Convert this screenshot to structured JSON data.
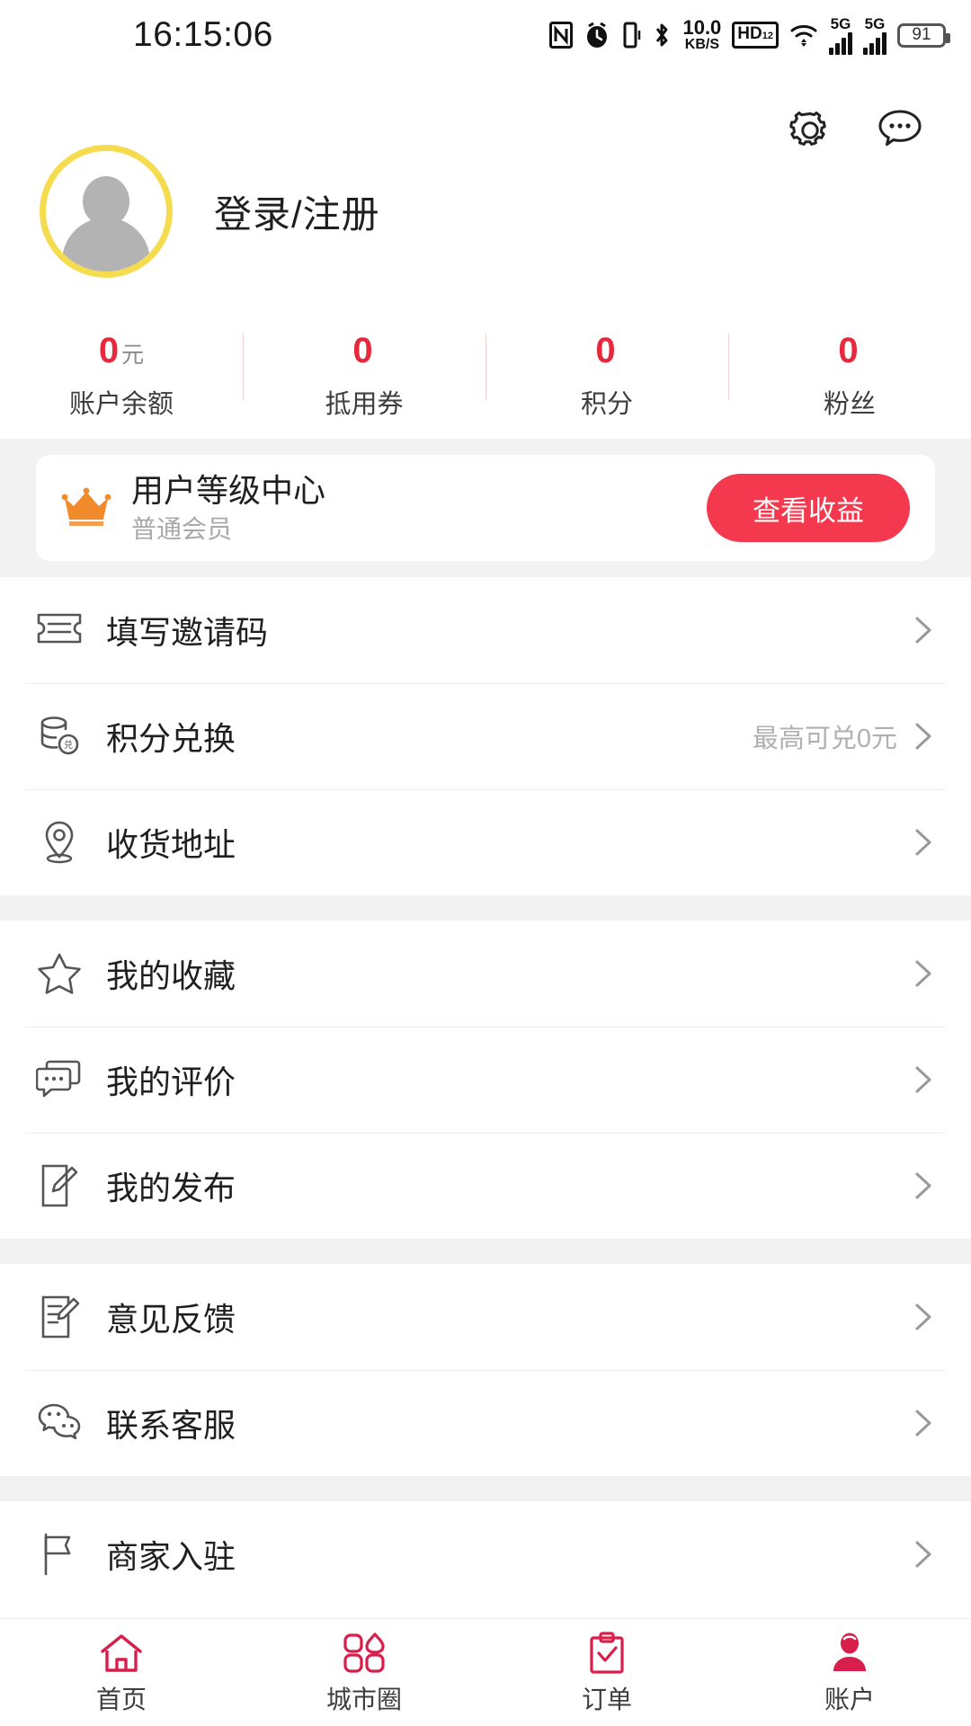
{
  "status_bar": {
    "time": "16:15:06",
    "network_speed_value": "10.0",
    "network_speed_unit": "KB/S",
    "hd_label": "HD",
    "hd_sup": "1",
    "hd_sub": "2",
    "sim1_label": "5G",
    "sim2_label": "5G",
    "battery_level": "91",
    "icons": [
      "nfc-icon",
      "alarm-icon",
      "vibrate-icon",
      "bluetooth-icon",
      "wifi-icon"
    ]
  },
  "header": {
    "settings_icon": "gear-icon",
    "message_icon": "chat-bubble-icon",
    "login_text": "登录/注册",
    "avatar_ring_color": "#F5DC4E"
  },
  "stats": [
    {
      "value": "0",
      "unit": "元",
      "label": "账户余额"
    },
    {
      "value": "0",
      "unit": "",
      "label": "抵用券"
    },
    {
      "value": "0",
      "unit": "",
      "label": "积分"
    },
    {
      "value": "0",
      "unit": "",
      "label": "粉丝"
    }
  ],
  "vip_card": {
    "icon": "crown-icon",
    "title": "用户等级中心",
    "subtitle": "普通会员",
    "button_label": "查看收益",
    "button_color": "#F4394E",
    "crown_color": "#F08A2A"
  },
  "menu_groups": [
    {
      "items": [
        {
          "icon": "ticket-icon",
          "label": "填写邀请码",
          "extra": ""
        },
        {
          "icon": "coins-icon",
          "label": "积分兑换",
          "extra": "最高可兑0元"
        },
        {
          "icon": "location-pin-icon",
          "label": "收货地址",
          "extra": ""
        }
      ]
    },
    {
      "items": [
        {
          "icon": "star-icon",
          "label": "我的收藏",
          "extra": ""
        },
        {
          "icon": "comment-icon",
          "label": "我的评价",
          "extra": ""
        },
        {
          "icon": "edit-note-icon",
          "label": "我的发布",
          "extra": ""
        }
      ]
    },
    {
      "items": [
        {
          "icon": "feedback-icon",
          "label": "意见反馈",
          "extra": ""
        },
        {
          "icon": "customer-service-icon",
          "label": "联系客服",
          "extra": ""
        }
      ]
    },
    {
      "items": [
        {
          "icon": "flag-icon",
          "label": "商家入驻",
          "extra": ""
        }
      ]
    }
  ],
  "tabbar": {
    "accent_color": "#D81E4A",
    "items": [
      {
        "icon": "home-icon",
        "label": "首页",
        "active": false
      },
      {
        "icon": "city-circle-icon",
        "label": "城市圈",
        "active": false
      },
      {
        "icon": "order-clipboard-icon",
        "label": "订单",
        "active": false
      },
      {
        "icon": "account-person-icon",
        "label": "账户",
        "active": true
      }
    ]
  }
}
